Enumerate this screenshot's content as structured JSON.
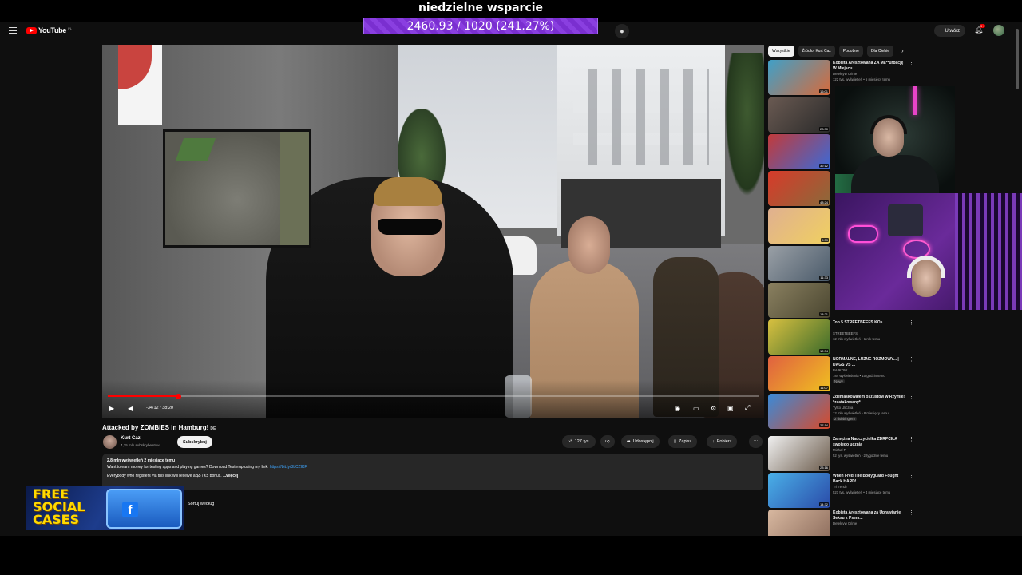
{
  "banner": {
    "title": "niedzielne wsparcie",
    "progress_text": "2460.93 / 1020 (241.27%)",
    "progress_percent": 241.27
  },
  "header": {
    "logo_text": "YouTube",
    "logo_region": "PL",
    "create_label": "Utwórz",
    "notification_count": "9+"
  },
  "player": {
    "time_text": "-34:12 / 38:20",
    "progress_fraction": 0.108
  },
  "video": {
    "title": "Attacked by ZOMBIES in Hamburg!",
    "title_tag": "DE",
    "channel": "Kurt Caz",
    "subscribers": "4,15 mln subskrybentów",
    "subscribe_label": "Subskrybuj",
    "likes": "127 tys.",
    "share_label": "Udostępnij",
    "save_label": "Zapisz",
    "download_label": "Pobierz"
  },
  "description": {
    "meta": "2,8 mln wyświetleń  2 miesiące temu",
    "line1": "Want to earn money for testing apps and playing games? Download Testerup using my link: ",
    "link": "https://bit.ly/3LCZIKF",
    "line2": "Everybody who registers via this link will receive a $5 / €5 bonus. ",
    "more": "...więcej"
  },
  "comments": {
    "sort_label": "Sortuj według"
  },
  "chips": [
    "Wszystkie",
    "Źródło: Kurt Caz",
    "Podobne",
    "Dla Ciebie"
  ],
  "recommendations": [
    {
      "title": "Kobieta Aresztowana ZA Ma**urbację W Miejscu ...",
      "channel": "Detektyw Crime",
      "meta": "122 tys. wyświetleń • 5 miesięcy temu",
      "duration": "16:01",
      "thumb": [
        "#3fa0c8",
        "#d86a3a"
      ]
    },
    {
      "title": "",
      "channel": "",
      "meta": "",
      "duration": "23:30",
      "thumb": [
        "#6a5a52",
        "#2a2a2a"
      ]
    },
    {
      "title": "",
      "channel": "",
      "meta": "",
      "duration": "32:12",
      "thumb": [
        "#c23a3a",
        "#3a6ad8"
      ]
    },
    {
      "title": "",
      "channel": "",
      "meta": "",
      "duration": "48:24",
      "thumb": [
        "#d83a2a",
        "#8a6a3a"
      ]
    },
    {
      "title": "",
      "channel": "",
      "meta": "",
      "duration": "9:39",
      "thumb": [
        "#e0b090",
        "#f0d060"
      ]
    },
    {
      "title": "",
      "channel": "",
      "meta": "",
      "duration": "11:33",
      "thumb": [
        "#9aa0a6",
        "#4a5a6a"
      ]
    },
    {
      "title": "",
      "channel": "",
      "meta": "",
      "duration": "18:21",
      "thumb": [
        "#8a8060",
        "#4a4630"
      ]
    },
    {
      "title": "Top 5 STREETBEEFS KOs",
      "channel": "STREETBEEFS",
      "meta": "12 mln wyświetleń • 1 rok temu",
      "duration": "12:34",
      "thumb": [
        "#d8c040",
        "#3a6a2a"
      ]
    },
    {
      "title": "NORMALNE, LUZNE ROZMOWY... | DAGS VS ...",
      "channel": "BAJKOW",
      "meta": "784 wyświetlenia • 10 godzin temu",
      "tag": "Nowy",
      "duration": "11:07",
      "thumb": [
        "#e06040",
        "#f0c020"
      ]
    },
    {
      "title": "Zdemaskowałem oszustów w Rzymie! *zaatakowany*",
      "channel": "Tylko Uliczna",
      "meta": "12 mln wyświetleń • 8 miesięcy temu",
      "tag": "2 dubbingiem",
      "duration": "27:14",
      "thumb": [
        "#3a8ad8",
        "#d84a2a"
      ]
    },
    {
      "title": "Zamężna Nauczycielka ZDRPCIŁA swojego ucznia",
      "channel": "Michał F.",
      "meta": "52 tys. wyświetleń • 2 tygodnie temu",
      "duration": "23:16",
      "thumb": [
        "#f0f0f0",
        "#6a5a4a"
      ]
    },
    {
      "title": "When Fred The Bodyguard Fought Back HARD!",
      "channel": "TriTrendz",
      "meta": "521 tys. wyświetleń • 4 miesiące temu",
      "duration": "14:32",
      "thumb": [
        "#4ab0e8",
        "#2a4aa8"
      ]
    },
    {
      "title": "Kobieta Aresztowana za Uprawianie Seksu z Psem...",
      "channel": "Detektyw Crime",
      "meta": "",
      "duration": "",
      "thumb": [
        "#d8b8a0",
        "#8a6a5a"
      ]
    }
  ],
  "promo": {
    "line1": "FREE",
    "line2": "SOCIAL",
    "line3": "CASES"
  },
  "icons": {
    "menu": "menu-icon",
    "search": "search-icon",
    "mic": "mic-icon",
    "bell": "bell-icon",
    "play": "play-icon",
    "volume": "volume-icon",
    "settings": "gear-icon"
  }
}
